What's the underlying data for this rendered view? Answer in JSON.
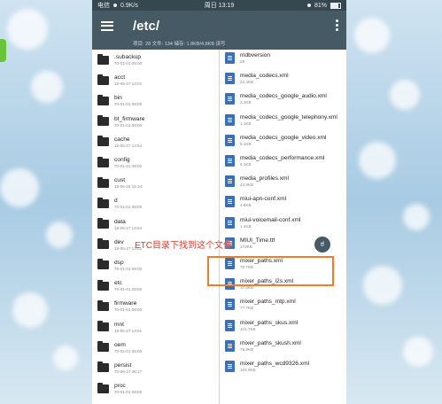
{
  "statusbar": {
    "carrier": "电信",
    "speed": "0.9K/s",
    "time": "周日 13:19",
    "battery": "81%"
  },
  "toolbar": {
    "path": "/etc/",
    "info": "项目: 28  文件: 134  储存: 1.8KB/4.8KB  读写"
  },
  "left_items": [
    {
      "name": ".subackup",
      "meta": "70-01-01 08:00"
    },
    {
      "name": "acct",
      "meta": "18-05-27 13:01"
    },
    {
      "name": "bin",
      "meta": "70-01-01 08:00"
    },
    {
      "name": "bt_firmware",
      "meta": "70-01-01 08:00"
    },
    {
      "name": "cache",
      "meta": "18-05-27 13:54"
    },
    {
      "name": "config",
      "meta": "70-01-01 08:00"
    },
    {
      "name": "cust",
      "meta": "18-05-26 16:34"
    },
    {
      "name": "d",
      "meta": "70-01-01 08:00"
    },
    {
      "name": "data",
      "meta": "18-05-27 13:54"
    },
    {
      "name": "dev",
      "meta": "18-05-27 13:01"
    },
    {
      "name": "dsp",
      "meta": "70-01-01 08:00"
    },
    {
      "name": "etc",
      "meta": "70-01-01 08:00"
    },
    {
      "name": "firmware",
      "meta": "70-01-01 08:00"
    },
    {
      "name": "mnt",
      "meta": "18-05-27 13:01"
    },
    {
      "name": "oem",
      "meta": "70-01-01 08:00"
    },
    {
      "name": "persist",
      "meta": "70-06-27 06:17"
    },
    {
      "name": "proc",
      "meta": "70-01-01 08:00"
    }
  ],
  "right_items": [
    {
      "name": "mdbversion",
      "meta": "28"
    },
    {
      "name": "media_codecs.xml",
      "meta": "22.4KB"
    },
    {
      "name": "media_codecs_google_audio.xml",
      "meta": "3.2KB"
    },
    {
      "name": "media_codecs_google_telephony.xml",
      "meta": "1.1KB"
    },
    {
      "name": "media_codecs_google_video.xml",
      "meta": "5.1KB"
    },
    {
      "name": "media_codecs_performance.xml",
      "meta": "8.1KB"
    },
    {
      "name": "media_profiles.xml",
      "meta": "44.9KB"
    },
    {
      "name": "miui-apn-conf.xml",
      "meta": "4.8KB"
    },
    {
      "name": "miui-voicemail-conf.xml",
      "meta": "1.4KB"
    },
    {
      "name": "MIUI_Time.ttf",
      "meta": "173KB"
    },
    {
      "name": "mixer_paths.xml",
      "meta": "78.7KB"
    },
    {
      "name": "mixer_paths_i2s.xml",
      "meta": "17.4KB"
    },
    {
      "name": "mixer_paths_mtp.xml",
      "meta": "77.7KB"
    },
    {
      "name": "mixer_paths_skus.xml",
      "meta": "101.7KB"
    },
    {
      "name": "mixer_paths_skush.xml",
      "meta": "78.8KB"
    },
    {
      "name": "mixer_paths_wcd9326.xml",
      "meta": "102.9KB"
    }
  ],
  "annotation": "ETC目录下找到这个文件",
  "colors": {
    "toolbar": "#455a64",
    "highlight": "#f07c2a",
    "annotation": "#e23a2a",
    "file_icon": "#3d6fb6"
  }
}
